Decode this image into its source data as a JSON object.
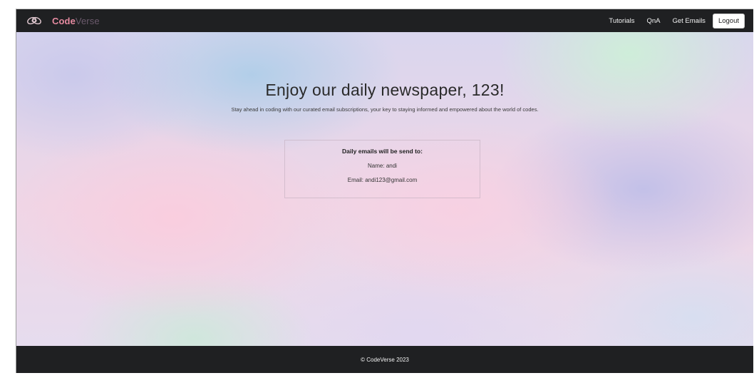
{
  "navbar": {
    "brand": {
      "logo_icon": "infinity-knot-icon",
      "name_bold": "Code",
      "name_light": "Verse"
    },
    "links": [
      "Tutorials",
      "QnA",
      "Get Emails"
    ],
    "logout_label": "Logout"
  },
  "hero": {
    "headline": "Enjoy our daily newspaper, 123!",
    "subline": "Stay ahead in coding with our curated email subscriptions, your key to staying informed and empowered about the world of codes."
  },
  "email_card": {
    "title": "Daily emails will be send to:",
    "name_line": "Name: andi",
    "email_line": "Email: andi123@gmail.com"
  },
  "footer": {
    "copyright": "© CodeVerse 2023"
  },
  "colors": {
    "navbar_bg": "#1f2022",
    "brand_accent": "#e58aa0",
    "footer_bg": "#1f2022"
  }
}
